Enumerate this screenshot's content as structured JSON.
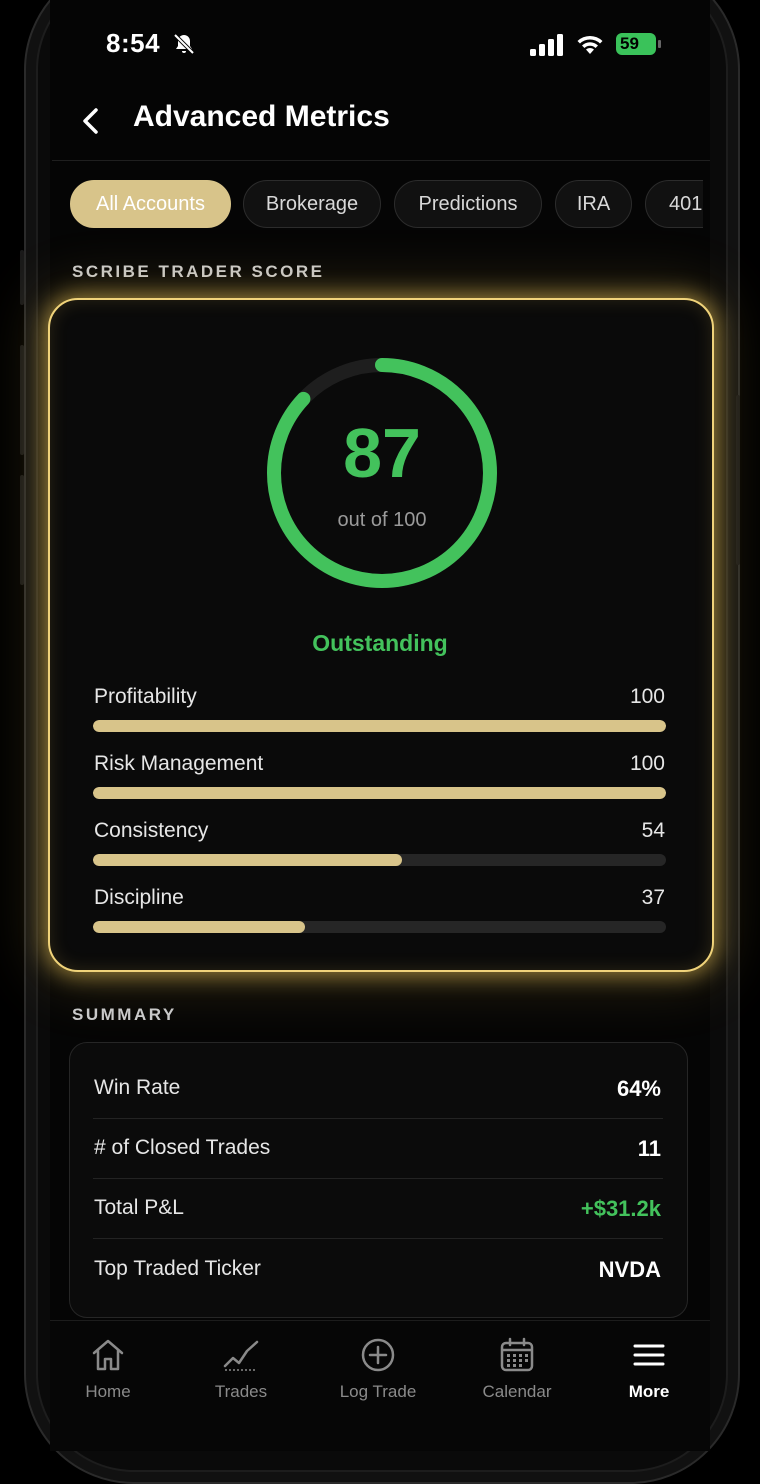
{
  "status_bar": {
    "time": "8:54",
    "battery": "59"
  },
  "header": {
    "title": "Advanced Metrics"
  },
  "tabs": [
    {
      "label": "All Accounts",
      "active": true
    },
    {
      "label": "Brokerage",
      "active": false
    },
    {
      "label": "Predictions",
      "active": false
    },
    {
      "label": "IRA",
      "active": false
    },
    {
      "label": "401",
      "active": false
    }
  ],
  "score_section": {
    "heading": "SCRIBE TRADER SCORE",
    "score": "87",
    "score_fraction": 0.87,
    "out_of": "out of 100",
    "rating": "Outstanding",
    "metrics": [
      {
        "label": "Profitability",
        "value": "100",
        "fraction": 1.0
      },
      {
        "label": "Risk Management",
        "value": "100",
        "fraction": 1.0
      },
      {
        "label": "Consistency",
        "value": "54",
        "fraction": 0.54
      },
      {
        "label": "Discipline",
        "value": "37",
        "fraction": 0.37
      }
    ]
  },
  "summary": {
    "heading": "SUMMARY",
    "rows": [
      {
        "label": "Win Rate",
        "value": "64%"
      },
      {
        "label": "# of Closed Trades",
        "value": "11"
      },
      {
        "label": "Total P&L",
        "value": "+$31.2k"
      },
      {
        "label": "Top Traded Ticker",
        "value": "NVDA"
      }
    ]
  },
  "nav": [
    {
      "label": "Home",
      "icon": "home-icon"
    },
    {
      "label": "Trades",
      "icon": "chart-line-icon"
    },
    {
      "label": "Log Trade",
      "icon": "plus-circle-icon"
    },
    {
      "label": "Calendar",
      "icon": "calendar-icon"
    },
    {
      "label": "More",
      "icon": "menu-icon",
      "active": true
    }
  ],
  "colors": {
    "accent_gold": "#d8c48a",
    "positive_green": "#43c25c",
    "glow": "#f0d37a"
  }
}
